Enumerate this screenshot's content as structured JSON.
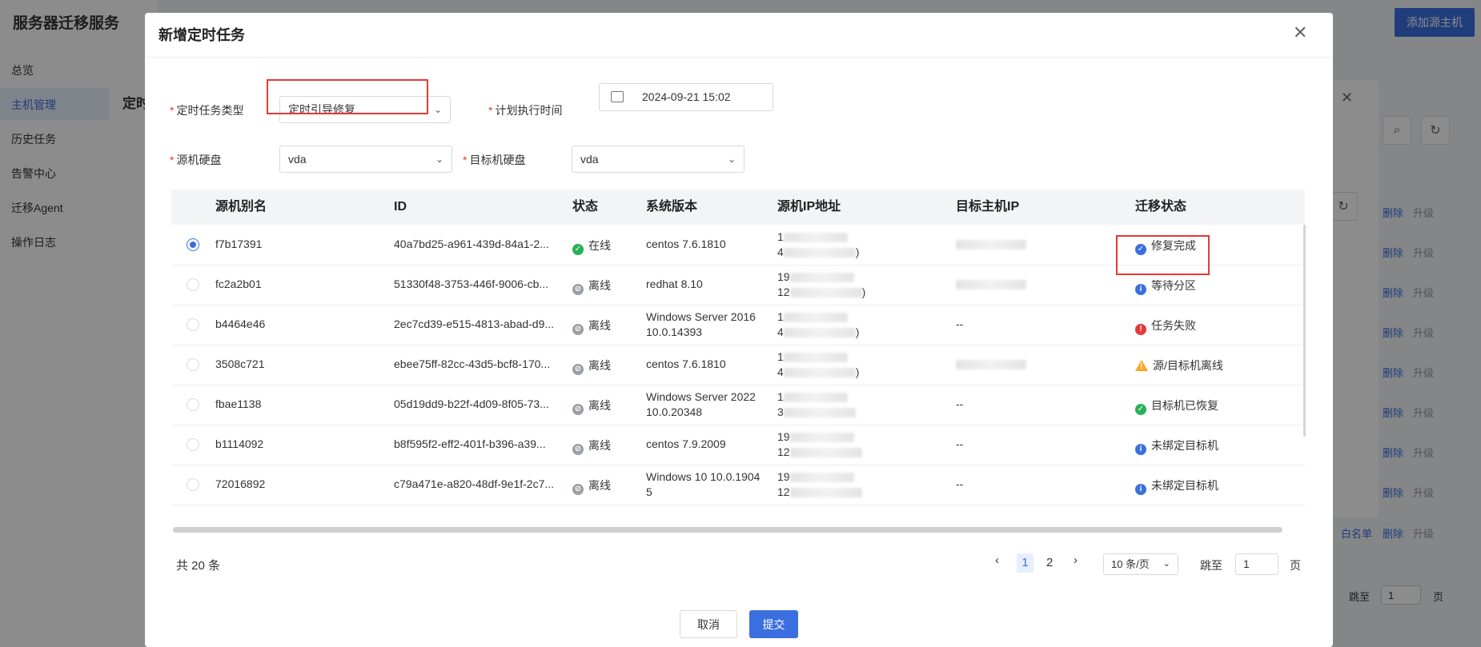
{
  "app": {
    "title": "服务器迁移服务",
    "nav": [
      "总览",
      "主机管理",
      "历史任务",
      "告警中心",
      "迁移Agent",
      "操作日志"
    ],
    "add_source_button": "添加源主机"
  },
  "bg_dialog": {
    "title": "定时",
    "row_actions": {
      "delete": "删除",
      "upgrade": "升级",
      "whitelist": "白名单"
    },
    "pagination": {
      "jump_label": "跳至",
      "page_value": "1",
      "page_suffix": "页"
    }
  },
  "dialog": {
    "title": "新增定时任务",
    "form": {
      "task_type_label": "定时任务类型",
      "task_type_value": "定时引导修复",
      "exec_time_label": "计划执行时间",
      "exec_time_value": "2024-09-21 15:02",
      "source_disk_label": "源机硬盘",
      "source_disk_value": "vda",
      "target_disk_label": "目标机硬盘",
      "target_disk_value": "vda",
      "required_mark": "*"
    },
    "table": {
      "columns": [
        "源机别名",
        "ID",
        "状态",
        "系统版本",
        "源机IP地址",
        "目标主机IP",
        "迁移状态"
      ],
      "rows": [
        {
          "alias": "f7b17391",
          "id": "40a7bd25-a961-439d-84a1-2...",
          "status": "在线",
          "status_type": "online",
          "os": [
            "centos 7.6.1810"
          ],
          "ip": [
            "1",
            "4",
            ")"
          ],
          "target_ip": "",
          "migrate": "修复完成",
          "migrate_type": "done-blue",
          "selected": true
        },
        {
          "alias": "fc2a2b01",
          "id": "51330f48-3753-446f-9006-cb...",
          "status": "离线",
          "status_type": "offline",
          "os": [
            "redhat 8.10"
          ],
          "ip": [
            "19",
            "12",
            ")"
          ],
          "target_ip": "",
          "migrate": "等待分区",
          "migrate_type": "info",
          "selected": false
        },
        {
          "alias": "b4464e46",
          "id": "2ec7cd39-e515-4813-abad-d9...",
          "status": "离线",
          "status_type": "offline",
          "os": [
            "Windows Server 2016",
            "10.0.14393"
          ],
          "ip": [
            "1",
            "4",
            ")"
          ],
          "target_ip": "--",
          "migrate": "任务失败",
          "migrate_type": "error",
          "selected": false
        },
        {
          "alias": "3508c721",
          "id": "ebee75ff-82cc-43d5-bcf8-170...",
          "status": "离线",
          "status_type": "offline",
          "os": [
            "centos 7.6.1810"
          ],
          "ip": [
            "1",
            "4",
            ")"
          ],
          "target_ip": "",
          "migrate": "源/目标机离线",
          "migrate_type": "warn",
          "selected": false
        },
        {
          "alias": "fbae1138",
          "id": "05d19dd9-b22f-4d09-8f05-73...",
          "status": "离线",
          "status_type": "offline",
          "os": [
            "Windows Server 2022",
            "10.0.20348"
          ],
          "ip": [
            "1",
            "3",
            ""
          ],
          "target_ip": "--",
          "migrate": "目标机已恢复",
          "migrate_type": "done-green",
          "selected": false
        },
        {
          "alias": "b1114092",
          "id": "b8f595f2-eff2-401f-b396-a39...",
          "status": "离线",
          "status_type": "offline",
          "os": [
            "centos 7.9.2009"
          ],
          "ip": [
            "19",
            "12",
            ""
          ],
          "target_ip": "--",
          "migrate": "未绑定目标机",
          "migrate_type": "info",
          "selected": false
        },
        {
          "alias": "72016892",
          "id": "c79a471e-a820-48df-9e1f-2c7...",
          "status": "离线",
          "status_type": "offline",
          "os": [
            "Windows 10 10.0.1904",
            "5"
          ],
          "ip": [
            "19",
            "12",
            ""
          ],
          "target_ip": "--",
          "migrate": "未绑定目标机",
          "migrate_type": "info",
          "selected": false
        }
      ]
    },
    "pagination": {
      "total": "共 20 条",
      "pages": [
        "1",
        "2"
      ],
      "current": "1",
      "page_size": "10 条/页",
      "jump_label": "跳至",
      "jump_value": "1",
      "page_suffix": "页"
    },
    "buttons": {
      "cancel": "取消",
      "submit": "提交"
    }
  }
}
